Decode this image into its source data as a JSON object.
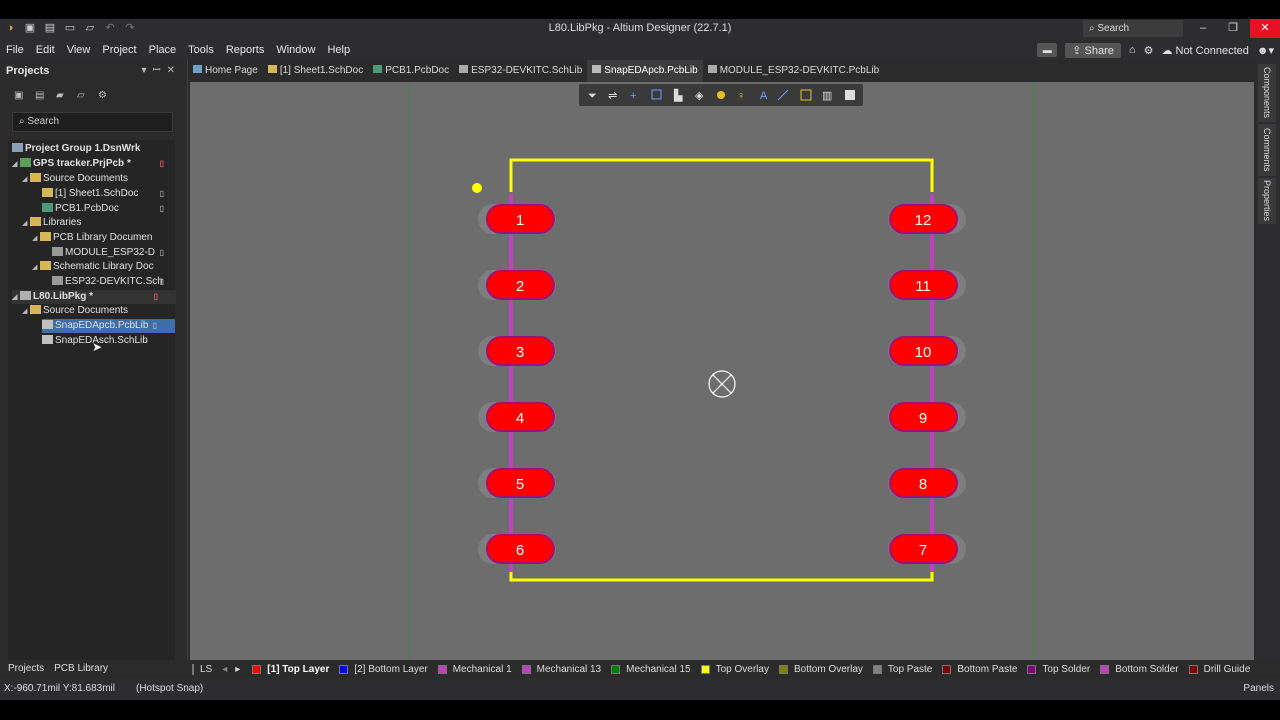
{
  "window": {
    "title": "L80.LibPkg - Altium Designer (22.7.1)",
    "search_placeholder": "Search",
    "min": "–",
    "max": "❐",
    "close": "✕"
  },
  "menu": [
    "File",
    "Edit",
    "View",
    "Project",
    "Place",
    "Tools",
    "Reports",
    "Window",
    "Help"
  ],
  "header_right": {
    "share": "Share",
    "connection": "Not Connected"
  },
  "projects_panel": {
    "title": "Projects",
    "search_placeholder": "Search",
    "tree": [
      {
        "label": "Project Group 1.DsnWrk",
        "bold": true
      },
      {
        "label": "GPS tracker.PrjPcb *",
        "bold": true
      },
      {
        "label": "Source Documents"
      },
      {
        "label": "[1] Sheet1.SchDoc"
      },
      {
        "label": "PCB1.PcbDoc"
      },
      {
        "label": "Libraries"
      },
      {
        "label": "PCB Library Documen"
      },
      {
        "label": "MODULE_ESP32-D"
      },
      {
        "label": "Schematic Library Doc"
      },
      {
        "label": "ESP32-DEVKITC.Sch"
      },
      {
        "label": "L80.LibPkg *",
        "bold": true
      },
      {
        "label": "Source Documents"
      },
      {
        "label": "SnapEDApcb.PcbLib"
      },
      {
        "label": "SnapEDAsch.SchLib"
      }
    ],
    "bottom_tabs": [
      "Projects",
      "PCB Library"
    ]
  },
  "doc_tabs": [
    "Home Page",
    "[1] Sheet1.SchDoc",
    "PCB1.PcbDoc",
    "ESP32-DEVKITC.SchLib",
    "SnapEDApcb.PcbLib",
    "MODULE_ESP32-DEVKITC.PcbLib"
  ],
  "right_panels": [
    "Components",
    "Comments",
    "Properties"
  ],
  "footprint": {
    "left_pads": [
      "1",
      "2",
      "3",
      "4",
      "5",
      "6"
    ],
    "right_pads": [
      "12",
      "11",
      "10",
      "9",
      "8",
      "7"
    ],
    "colors": {
      "pad": "#ff0000",
      "overlay": "#ffff00",
      "mechanical": "#c040c0",
      "board_bg": "#6d6d6d"
    }
  },
  "layers": {
    "ls_label": "LS",
    "items": [
      {
        "label": "[1] Top Layer",
        "color": "#ff0000",
        "active": true
      },
      {
        "label": "[2] Bottom Layer",
        "color": "#0000ff"
      },
      {
        "label": "Mechanical 1",
        "color": "#c040c0"
      },
      {
        "label": "Mechanical 13",
        "color": "#c040c0"
      },
      {
        "label": "Mechanical 15",
        "color": "#008000"
      },
      {
        "label": "Top Overlay",
        "color": "#ffff00"
      },
      {
        "label": "Bottom Overlay",
        "color": "#808000"
      },
      {
        "label": "Top Paste",
        "color": "#808080"
      },
      {
        "label": "Bottom Paste",
        "color": "#800000"
      },
      {
        "label": "Top Solder",
        "color": "#800080"
      },
      {
        "label": "Bottom Solder",
        "color": "#c040c0"
      },
      {
        "label": "Drill Guide",
        "color": "#800000"
      }
    ]
  },
  "status": {
    "coords": "X:-960.71mil Y:81.683mil",
    "snap": "(Hotspot Snap)",
    "panels": "Panels"
  }
}
